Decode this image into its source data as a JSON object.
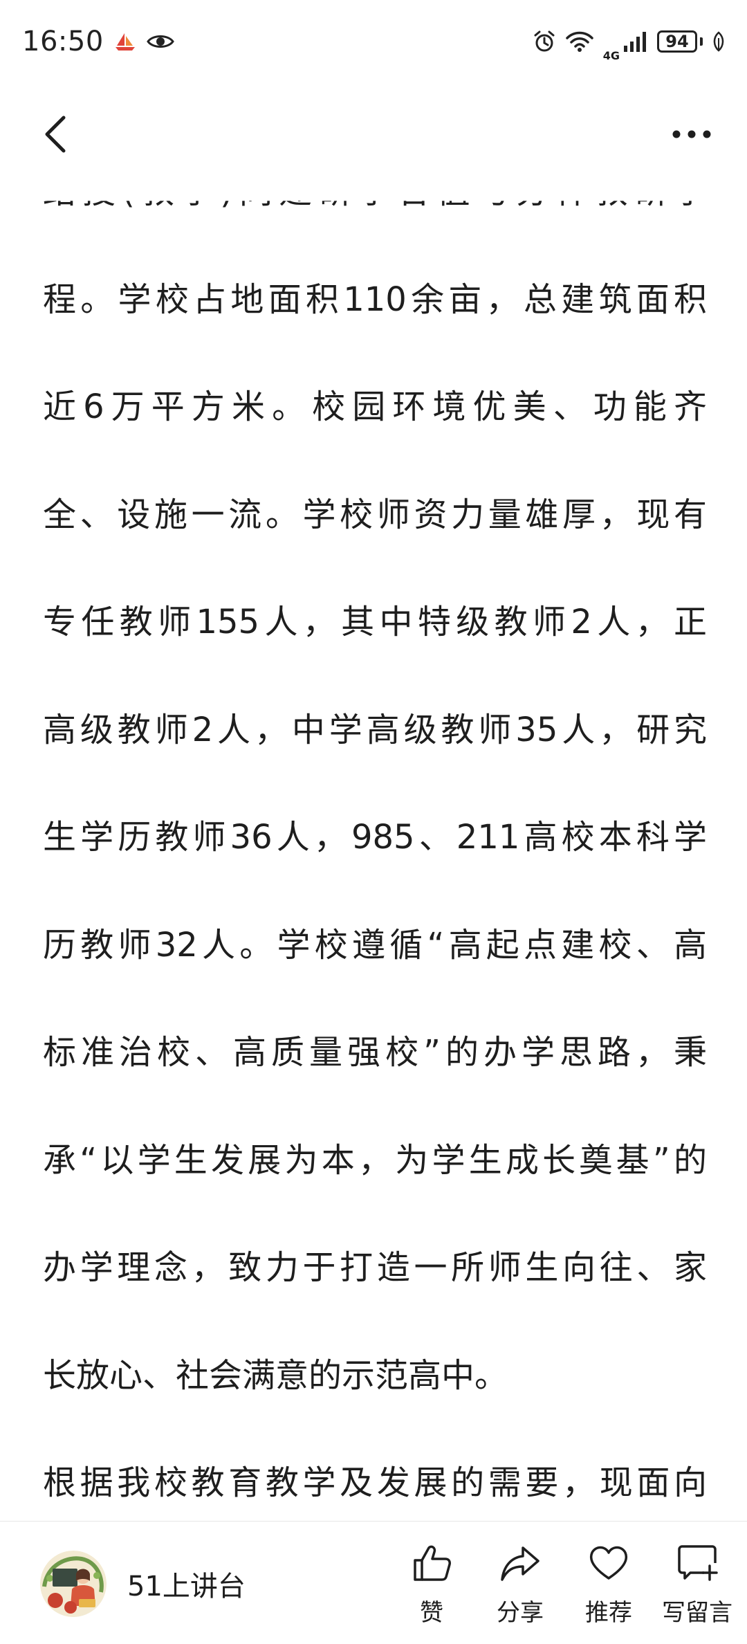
{
  "status_bar": {
    "time": "16:50",
    "network": "4G",
    "battery": "94"
  },
  "article": {
    "partial_top_line": "结授(教学)同建研学合值与分样教研学",
    "lines": [
      "程。学校占地面积110余亩，总建筑面积",
      "近6万平方米。校园环境优美、功能齐",
      "全、设施一流。学校师资力量雄厚，现有",
      "专任教师155人，其中特级教师2人，正",
      "高级教师2人，中学高级教师35人，研究",
      "生学历教师36人，985、211高校本科学",
      "历教师32人。学校遵循“高起点建校、高",
      "标准治校、高质量强校”的办学思路，秉",
      "承“以学生发展为本，为学生成长奠基”的",
      "办学理念，致力于打造一所师生向往、家",
      "长放心、社会满意的示范高中。"
    ],
    "next_paragraph": "根据我校教育教学及发展的需要，现面向"
  },
  "bottom_bar": {
    "account_name": "51上讲台",
    "actions": {
      "like": "赞",
      "share": "分享",
      "recommend": "推荐",
      "comment": "写留言"
    }
  },
  "colors": {
    "text": "#1e1e1e",
    "divider": "#e6e6e6",
    "background": "#ffffff"
  }
}
